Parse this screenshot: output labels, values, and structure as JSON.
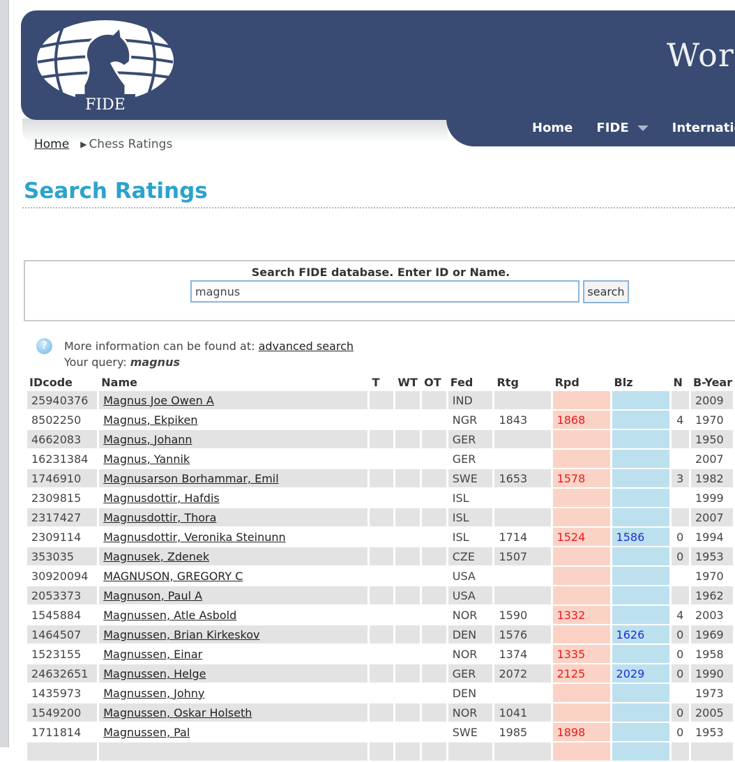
{
  "header": {
    "logo_text": "FIDE",
    "site_title": "World",
    "nav": [
      "Home",
      "FIDE",
      "International"
    ]
  },
  "breadcrumb": {
    "home": "Home",
    "current": "Chess Ratings"
  },
  "page_title": "Search Ratings",
  "search": {
    "caption": "Search FIDE database. Enter ID or Name.",
    "value": "magnus",
    "button": "search"
  },
  "info": {
    "prefix": "More information can be found at: ",
    "link": "advanced search",
    "query_label": "Your query: ",
    "query_value": "magnus"
  },
  "table": {
    "headers": [
      "IDcode",
      "Name",
      "T",
      "WT",
      "OT",
      "Fed",
      "Rtg",
      "Rpd",
      "Blz",
      "N",
      "B-Year"
    ],
    "rows": [
      {
        "id": "25940376",
        "name": "Magnus Joe Owen A",
        "fed": "IND",
        "rtg": "",
        "rpd": "",
        "blz": "",
        "n": "",
        "byear": "2009"
      },
      {
        "id": "8502250",
        "name": "Magnus, Ekpiken",
        "fed": "NGR",
        "rtg": "1843",
        "rpd": "1868",
        "blz": "",
        "n": "4",
        "byear": "1970"
      },
      {
        "id": "4662083",
        "name": "Magnus, Johann",
        "fed": "GER",
        "rtg": "",
        "rpd": "",
        "blz": "",
        "n": "",
        "byear": "1950"
      },
      {
        "id": "16231384",
        "name": "Magnus, Yannik",
        "fed": "GER",
        "rtg": "",
        "rpd": "",
        "blz": "",
        "n": "",
        "byear": "2007"
      },
      {
        "id": "1746910",
        "name": "Magnusarson Borhammar, Emil",
        "fed": "SWE",
        "rtg": "1653",
        "rpd": "1578",
        "blz": "",
        "n": "3",
        "byear": "1982"
      },
      {
        "id": "2309815",
        "name": "Magnusdottir, Hafdis",
        "fed": "ISL",
        "rtg": "",
        "rpd": "",
        "blz": "",
        "n": "",
        "byear": "1999"
      },
      {
        "id": "2317427",
        "name": "Magnusdottir, Thora",
        "fed": "ISL",
        "rtg": "",
        "rpd": "",
        "blz": "",
        "n": "",
        "byear": "2007"
      },
      {
        "id": "2309114",
        "name": "Magnusdottir, Veronika Steinunn",
        "fed": "ISL",
        "rtg": "1714",
        "rpd": "1524",
        "blz": "1586",
        "n": "0",
        "byear": "1994"
      },
      {
        "id": "353035",
        "name": "Magnusek, Zdenek",
        "fed": "CZE",
        "rtg": "1507",
        "rpd": "",
        "blz": "",
        "n": "0",
        "byear": "1953"
      },
      {
        "id": "30920094",
        "name": "MAGNUSON, GREGORY C",
        "fed": "USA",
        "rtg": "",
        "rpd": "",
        "blz": "",
        "n": "",
        "byear": "1970"
      },
      {
        "id": "2053373",
        "name": "Magnuson, Paul A",
        "fed": "USA",
        "rtg": "",
        "rpd": "",
        "blz": "",
        "n": "",
        "byear": "1962"
      },
      {
        "id": "1545884",
        "name": "Magnussen, Atle Asbold",
        "fed": "NOR",
        "rtg": "1590",
        "rpd": "1332",
        "blz": "",
        "n": "4",
        "byear": "2003"
      },
      {
        "id": "1464507",
        "name": "Magnussen, Brian Kirkeskov",
        "fed": "DEN",
        "rtg": "1576",
        "rpd": "",
        "blz": "1626",
        "n": "0",
        "byear": "1969"
      },
      {
        "id": "1523155",
        "name": "Magnussen, Einar",
        "fed": "NOR",
        "rtg": "1374",
        "rpd": "1335",
        "blz": "",
        "n": "0",
        "byear": "1958"
      },
      {
        "id": "24632651",
        "name": "Magnussen, Helge",
        "fed": "GER",
        "rtg": "2072",
        "rpd": "2125",
        "blz": "2029",
        "n": "0",
        "byear": "1990"
      },
      {
        "id": "1435973",
        "name": "Magnussen, Johny",
        "fed": "DEN",
        "rtg": "",
        "rpd": "",
        "blz": "",
        "n": "",
        "byear": "1973"
      },
      {
        "id": "1549200",
        "name": "Magnussen, Oskar Holseth",
        "fed": "NOR",
        "rtg": "1041",
        "rpd": "",
        "blz": "",
        "n": "0",
        "byear": "2005"
      },
      {
        "id": "1711814",
        "name": "Magnussen, Pal",
        "fed": "SWE",
        "rtg": "1985",
        "rpd": "1898",
        "blz": "",
        "n": "0",
        "byear": "1953"
      },
      {
        "id": "",
        "name": "",
        "fed": "",
        "rtg": "",
        "rpd": "",
        "blz": "",
        "n": "",
        "byear": ""
      }
    ]
  }
}
